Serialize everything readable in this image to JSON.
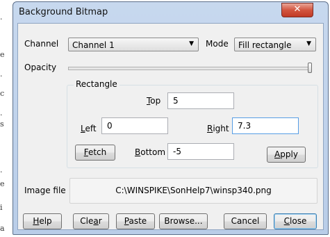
{
  "margin_glyphs": [
    ".",
    "e",
    ".",
    "c",
    ".",
    "s",
    ".",
    "e",
    "i",
    "a"
  ],
  "window": {
    "title": "Background Bitmap",
    "close_glyph": "✕"
  },
  "channel": {
    "label": "Channel",
    "value": "Channel 1"
  },
  "mode": {
    "label": "Mode",
    "value": "Fill rectangle"
  },
  "opacity": {
    "label": "Opacity",
    "level": 1.0
  },
  "rectangle": {
    "group_label": "Rectangle",
    "top": {
      "label": [
        "",
        "T",
        "op"
      ],
      "value": "5"
    },
    "left": {
      "label": [
        "",
        "L",
        "eft"
      ],
      "value": "0"
    },
    "right": {
      "label": [
        "",
        "R",
        "ight"
      ],
      "value": "7.3"
    },
    "bottom": {
      "label": [
        "",
        "B",
        "ottom"
      ],
      "value": "-5"
    },
    "fetch_button": [
      "",
      "F",
      "etch"
    ],
    "apply_button": [
      "",
      "A",
      "pply"
    ]
  },
  "image_file": {
    "label": "Image file",
    "path": "C:\\WINSPIKE\\SonHelp7\\winsp340.png"
  },
  "buttons": {
    "help": [
      "",
      "H",
      "elp"
    ],
    "clear": [
      "Cle",
      "a",
      "r"
    ],
    "paste": [
      "",
      "P",
      "aste"
    ],
    "browse": [
      "Browse...",
      "",
      ""
    ],
    "cancel": [
      "Cancel",
      "",
      ""
    ],
    "close": [
      "",
      "C",
      "lose"
    ]
  },
  "colors": {
    "titlebar": "#c7d8ee",
    "close_button": "#c13a25",
    "focus_border": "#569de5"
  }
}
